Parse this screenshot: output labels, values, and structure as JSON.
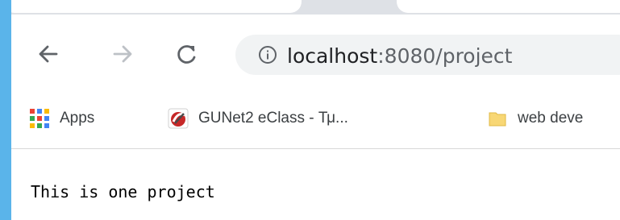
{
  "address_bar": {
    "host": "localhost",
    "path": ":8080/project"
  },
  "bookmarks": [
    {
      "label": "Apps",
      "icon": "apps-grid-icon"
    },
    {
      "label": "GUNet2 eClass - Τμ...",
      "icon": "eclass-logo-icon"
    },
    {
      "label": "web deve",
      "icon": "folder-icon"
    }
  ],
  "page": {
    "body_text": "This is one project"
  },
  "colors": {
    "desktop_bg": "#5ab4ea",
    "tabstrip_bg": "#dee1e6",
    "omnibox_bg": "#f1f3f4",
    "folder": "#f8d775"
  }
}
